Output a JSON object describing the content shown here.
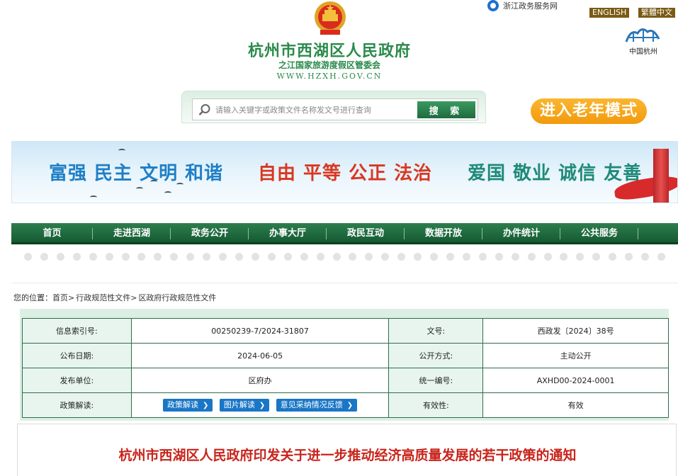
{
  "top": {
    "zj_link": "浙江政务服务网",
    "english": "ENGLISH",
    "traditional": "繁體中文",
    "hz_logo_text": "中国杭州"
  },
  "header": {
    "title": "杭州市西湖区人民政府",
    "subtitle": "之江国家旅游度假区管委会",
    "url": "WWW.HZXH.GOV.CN"
  },
  "search": {
    "placeholder": "请输入关键字或政策文件名称发文号进行查询",
    "button": "搜 索"
  },
  "elder_mode": "进入老年模式",
  "banner": {
    "group1": "富强 民主 文明 和谐",
    "group2": "自由 平等 公正 法治",
    "group3": "爱国 敬业 诚信 友善"
  },
  "nav": [
    "首页",
    "走进西湖",
    "政务公开",
    "办事大厅",
    "政民互动",
    "数据开放",
    "办件统计",
    "公共服务"
  ],
  "breadcrumb": [
    "您的位置：",
    "首页>",
    "行政规范性文件>",
    "区政府行政规范性文件"
  ],
  "info": {
    "index_label": "信息索引号:",
    "index_value": "00250239-7/2024-31807",
    "doc_no_label": "文号:",
    "doc_no_value": "西政发〔2024〕38号",
    "date_label": "公布日期:",
    "date_value": "2024-06-05",
    "open_mode_label": "公开方式:",
    "open_mode_value": "主动公开",
    "unit_label": "发布单位:",
    "unit_value": "区府办",
    "serial_label": "统一编号:",
    "serial_value": "AXHD00-2024-0001",
    "interp_label": "政策解读:",
    "interp_buttons": [
      "政策解读",
      "图片解读",
      "意见采纳情况反馈"
    ],
    "validity_label": "有效性:",
    "validity_value": "有效"
  },
  "article_title": "杭州市西湖区人民政府印发关于进一步推动经济高质量发展的若干政策的通知"
}
